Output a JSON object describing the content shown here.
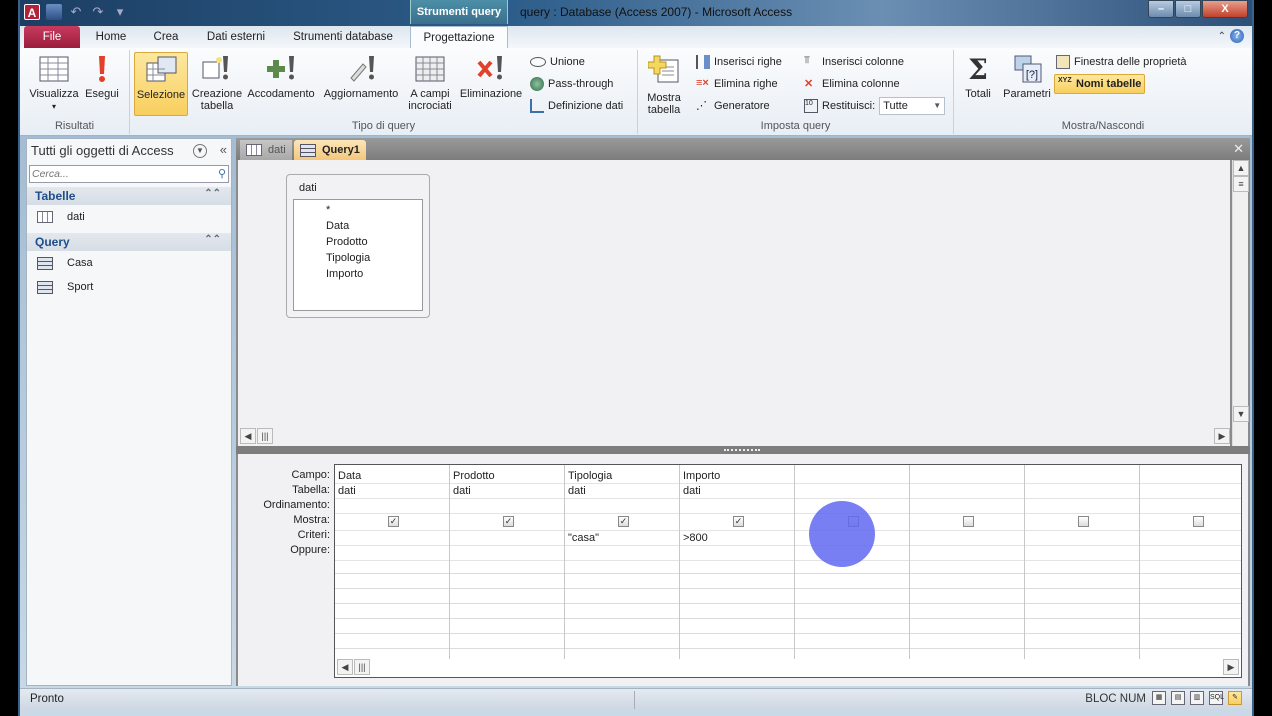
{
  "window": {
    "title": "query : Database (Access 2007)  -  Microsoft Access",
    "contextual_tab_group": "Strumenti query",
    "controls": {
      "minimize": "–",
      "maximize": "□",
      "close": "X"
    }
  },
  "quick_access": {
    "app_icon": "A",
    "icons": [
      "save-icon",
      "undo-icon",
      "redo-icon",
      "customize-icon"
    ]
  },
  "ribbon_tabs": [
    {
      "label": "File"
    },
    {
      "label": "Home"
    },
    {
      "label": "Crea"
    },
    {
      "label": "Dati esterni"
    },
    {
      "label": "Strumenti database"
    },
    {
      "label": "Progettazione",
      "active": true
    }
  ],
  "ribbon": {
    "groups": {
      "risultati": {
        "label": "Risultati",
        "buttons": [
          {
            "label": "Visualizza",
            "icon": "datasheet-view-icon"
          },
          {
            "label": "Esegui",
            "icon": "run-icon"
          }
        ]
      },
      "tipo_query": {
        "label": "Tipo di query",
        "buttons": [
          {
            "label": "Selezione",
            "icon": "select-query-icon",
            "selected": true
          },
          {
            "label": "Creazione tabella",
            "line1": "Creazione",
            "line2": "tabella",
            "icon": "make-table-icon"
          },
          {
            "label": "Accodamento",
            "icon": "append-icon"
          },
          {
            "label": "Aggiornamento",
            "icon": "update-icon"
          },
          {
            "label": "A campi incrociati",
            "line1": "A campi",
            "line2": "incrociati",
            "icon": "crosstab-icon"
          },
          {
            "label": "Eliminazione",
            "icon": "delete-query-icon"
          }
        ],
        "small": [
          {
            "label": "Unione",
            "icon": "union-icon"
          },
          {
            "label": "Pass-through",
            "icon": "pass-through-icon"
          },
          {
            "label": "Definizione dati",
            "icon": "data-definition-icon"
          }
        ]
      },
      "imposta_query": {
        "label": "Imposta query",
        "big": {
          "line1": "Mostra",
          "line2": "tabella",
          "icon": "show-table-icon"
        },
        "small": [
          {
            "label": "Inserisci righe"
          },
          {
            "label": "Elimina righe"
          },
          {
            "label": "Generatore"
          },
          {
            "label": "Inserisci colonne"
          },
          {
            "label": "Elimina colonne"
          },
          {
            "label": "Restituisci:"
          }
        ],
        "return_value": "Tutte"
      },
      "mostra_nascondi": {
        "label": "Mostra/Nascondi",
        "buttons": [
          {
            "label": "Totali",
            "icon": "sigma-icon"
          },
          {
            "label": "Parametri",
            "icon": "parameters-icon"
          }
        ],
        "small": [
          {
            "label": "Finestra delle proprietà"
          },
          {
            "label": "Nomi tabelle",
            "selected": true
          }
        ]
      }
    }
  },
  "nav_pane": {
    "title": "Tutti gli oggetti di Access",
    "search_placeholder": "Cerca...",
    "sections": [
      {
        "label": "Tabelle",
        "items": [
          {
            "label": "dati",
            "type": "table"
          }
        ]
      },
      {
        "label": "Query",
        "items": [
          {
            "label": "Casa",
            "type": "query"
          },
          {
            "label": "Sport",
            "type": "query"
          }
        ]
      }
    ]
  },
  "doc_tabs": [
    {
      "label": "dati",
      "active": false
    },
    {
      "label": "Query1",
      "active": true
    }
  ],
  "table_box": {
    "name": "dati",
    "fields": [
      "*",
      "Data",
      "Prodotto",
      "Tipologia",
      "Importo"
    ]
  },
  "qbe": {
    "row_labels": [
      "Campo:",
      "Tabella:",
      "Ordinamento:",
      "Mostra:",
      "Criteri:",
      "Oppure:"
    ],
    "columns": [
      {
        "campo": "Data",
        "tabella": "dati",
        "ordinamento": "",
        "mostra": true,
        "criteri": ""
      },
      {
        "campo": "Prodotto",
        "tabella": "dati",
        "ordinamento": "",
        "mostra": true,
        "criteri": ""
      },
      {
        "campo": "Tipologia",
        "tabella": "dati",
        "ordinamento": "",
        "mostra": true,
        "criteri": "\"casa\""
      },
      {
        "campo": "Importo",
        "tabella": "dati",
        "ordinamento": "",
        "mostra": true,
        "criteri": ">800"
      },
      {
        "campo": "",
        "tabella": "",
        "ordinamento": "",
        "mostra": false,
        "criteri": ""
      },
      {
        "campo": "",
        "tabella": "",
        "ordinamento": "",
        "mostra": false,
        "criteri": ""
      },
      {
        "campo": "",
        "tabella": "",
        "ordinamento": "",
        "mostra": false,
        "criteri": ""
      },
      {
        "campo": "",
        "tabella": "",
        "ordinamento": "",
        "mostra": false,
        "criteri": ""
      }
    ]
  },
  "status": {
    "left": "Pronto",
    "indicator": "BLOC NUM",
    "views": [
      "datasheet",
      "pivot-table",
      "pivot-chart",
      "SQL",
      "design"
    ]
  }
}
